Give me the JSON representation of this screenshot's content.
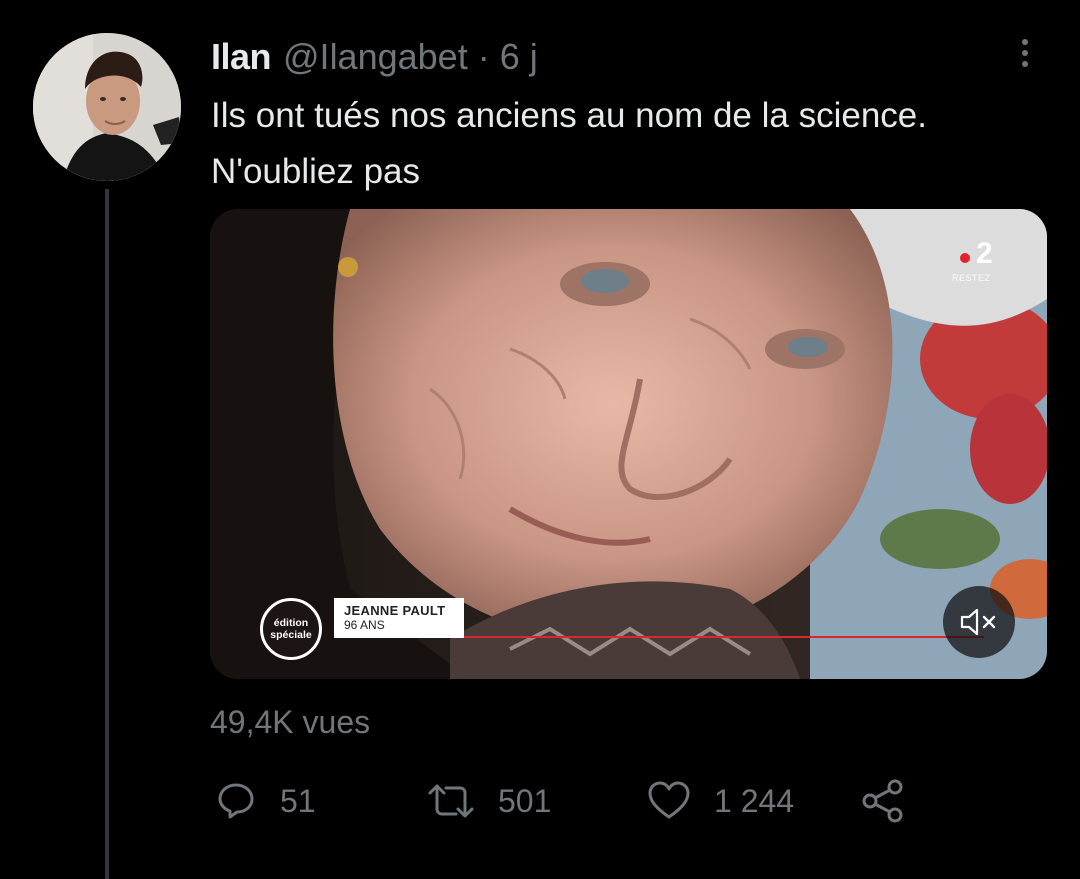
{
  "author": {
    "display_name": "Ilan",
    "handle": "@Ilangabet",
    "separator": "·",
    "time": "6 j"
  },
  "tweet": {
    "text_line_1": "Ils ont tués nos anciens au nom de la science.",
    "text_line_2": "N'oubliez pas"
  },
  "media": {
    "badge_line_1": "édition",
    "badge_line_2": "spéciale",
    "caption_name": "JEANNE PAULT",
    "caption_age": "96 ANS",
    "channel_number": "2",
    "channel_tagline": "RESTEZ",
    "mute_icon": "speaker-muted-icon"
  },
  "stats": {
    "views": "49,4K vues"
  },
  "actions": {
    "reply": {
      "icon": "reply-icon",
      "count": "51"
    },
    "retweet": {
      "icon": "retweet-icon",
      "count": "501"
    },
    "like": {
      "icon": "heart-icon",
      "count": "1 244"
    },
    "share": {
      "icon": "share-icon"
    }
  },
  "colors": {
    "background": "#000000",
    "primary_text": "#e7e9ea",
    "secondary_text": "#71767b",
    "thread_line": "#333639",
    "channel_red": "#e3212b"
  }
}
